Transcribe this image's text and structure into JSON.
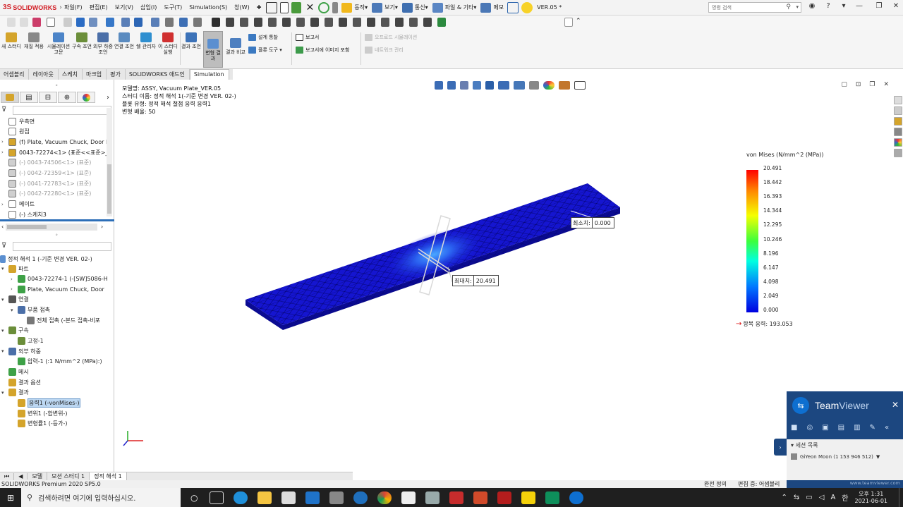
{
  "app": {
    "logo_text": "SOLIDWORKS",
    "doc_title": "VER.05 *",
    "search_placeholder": "명령 검색"
  },
  "menu": [
    "파일(F)",
    "편집(E)",
    "보기(V)",
    "삽입(I)",
    "도구(T)",
    "Simulation(S)",
    "창(W)"
  ],
  "quick": {
    "motion": "동작",
    "view": "보기",
    "comm": "통신",
    "files": "파일 & 기타",
    "memo": "메모"
  },
  "ribbon": {
    "buttons": [
      "새 스터디",
      "재질 적용",
      "시뮬레이션 고문",
      "구속 조언",
      "외부 하중 조언",
      "연결 조언",
      "쉘 관리자",
      "이 스터디 실행",
      "결과 조언",
      "변형 결과",
      "결과 비교"
    ],
    "small": {
      "design_insight": "설계 통찰",
      "plot_tools": "플롯 도구",
      "report": "보고서",
      "include_image": "보고서에 이미지 포함",
      "offload": "오프로드 시뮬레이션",
      "network": "네트워크 관리"
    }
  },
  "tabs": [
    {
      "label": "어셈블리",
      "active": false
    },
    {
      "label": "레이아웃",
      "active": false
    },
    {
      "label": "스케치",
      "active": false
    },
    {
      "label": "마크업",
      "active": false
    },
    {
      "label": "평가",
      "active": false
    },
    {
      "label": "SOLIDWORKS 애드인",
      "active": false
    },
    {
      "label": "Simulation",
      "active": true
    }
  ],
  "feature_tree": [
    {
      "label": "우측면",
      "dim": false
    },
    {
      "label": "원점",
      "dim": false
    },
    {
      "label": "(f) Plate, Vacuum Chuck, Door P",
      "dim": false
    },
    {
      "label": "0043-72274<1> (표준<<표준>_",
      "dim": false
    },
    {
      "label": "(-) 0043-74506<1> (표준)",
      "dim": true
    },
    {
      "label": "(-) 0042-72359<1> (표준)",
      "dim": true
    },
    {
      "label": "(-) 0041-72783<1> (표준)",
      "dim": true
    },
    {
      "label": "(-) 0042-72280<1> (표준)",
      "dim": true
    },
    {
      "label": "메이트",
      "dim": false
    },
    {
      "label": "(-) 스케치3",
      "dim": false
    }
  ],
  "sim_tree": {
    "study": "정적 해석 1 (-기준 변경 VER. 02-)",
    "rows": [
      {
        "label": "파트",
        "level": 0
      },
      {
        "label": "0043-72274-1 (-[SW]5086-H",
        "level": 1
      },
      {
        "label": "Plate, Vacuum Chuck, Door",
        "level": 1
      },
      {
        "label": "연결",
        "level": 0
      },
      {
        "label": "부품 접촉",
        "level": 1
      },
      {
        "label": "전체 접촉 (-본드 접촉-비포",
        "level": 2
      },
      {
        "label": "구속",
        "level": 0
      },
      {
        "label": "고정-1",
        "level": 1
      },
      {
        "label": "외부 하중",
        "level": 0
      },
      {
        "label": "압력-1 (:1 N/mm^2 (MPa):)",
        "level": 1
      },
      {
        "label": "메시",
        "level": 0
      },
      {
        "label": "결과 옵션",
        "level": 0
      },
      {
        "label": "결과",
        "level": 0
      },
      {
        "label": "응력1 (-vonMises-)",
        "level": 1,
        "selected": true
      },
      {
        "label": "변위1 (-합변위-)",
        "level": 1
      },
      {
        "label": "변형률1 (-등가-)",
        "level": 1
      }
    ]
  },
  "bottom_tabs": [
    {
      "label": "모델",
      "active": false
    },
    {
      "label": "모션 스터디 1",
      "active": false
    },
    {
      "label": "정적 해석 1",
      "active": true
    }
  ],
  "status": {
    "product": "SOLIDWORKS Premium 2020 SP5.0",
    "full_def": "완전 정의",
    "editing": "편집 중: 어셈블리"
  },
  "graphics": {
    "info": [
      "모델명: ASSY, Vacuum Plate_VER.05",
      "스터디 이름: 정적 해석 1(-기준 변경 VER. 02-)",
      "플롯 유형: 정적 해석 절점 응력 응력1",
      "변형 배율: 50"
    ],
    "legend_title": "von Mises (N/mm^2 (MPa))",
    "legend_values": [
      "20.491",
      "18.442",
      "16.393",
      "14.344",
      "12.295",
      "10.246",
      "8.196",
      "6.147",
      "4.098",
      "2.049",
      "0.000"
    ],
    "yield_label": "항복 응력: 193.053",
    "min_label": "최소치:",
    "min_value": "0.000",
    "max_label": "최대치:",
    "max_value": "20.491"
  },
  "teamviewer": {
    "title_a": "Team",
    "title_b": "Viewer",
    "session_header": "세션 목록",
    "session_user": "GiYeon Moon (1 153 946 512)",
    "url": "www.teamviewer.com"
  },
  "taskbar": {
    "search_placeholder": "검색하려면 여기에 입력하십시오.",
    "time": "오후 1:31",
    "date": "2021-06-01",
    "ime": "A",
    "ime2": "한"
  },
  "colors": {
    "accent": "#2d6fb8",
    "brand": "#d21f26",
    "plate_blue": "#1515d0"
  }
}
